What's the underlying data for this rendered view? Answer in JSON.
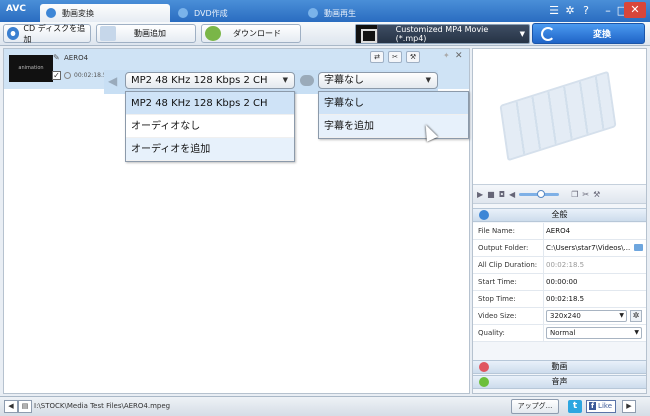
{
  "titlebar": {
    "app_logo": "AVC",
    "tabs": [
      {
        "label": "動画変換",
        "active": true
      },
      {
        "label": "DVD作成",
        "active": false
      },
      {
        "label": "動画再生",
        "active": false
      }
    ]
  },
  "toolbar": {
    "add_cd_label": "CD ディスクを追加",
    "add_video_label": "動画追加",
    "download_label": "ダウンロード",
    "output_format": "Customized MP4 Movie (*.mp4)",
    "convert_label": "変換"
  },
  "file": {
    "name": "AERO4",
    "duration": "00:02:18.5",
    "checked": true
  },
  "audio": {
    "selected": "MP2 48 KHz 128 Kbps 2 CH",
    "options": [
      "MP2 48 KHz 128 Kbps 2 CH",
      "オーディオなし",
      "オーディオを追加"
    ]
  },
  "subtitle": {
    "selected": "字幕なし",
    "options": [
      "字幕なし",
      "字幕を追加"
    ]
  },
  "properties": {
    "general_header": "全般",
    "rows": [
      {
        "label": "File Name:",
        "value": "AERO4"
      },
      {
        "label": "Output Folder:",
        "value": "C:\\Users\\star7\\Videos\\..."
      },
      {
        "label": "All Clip Duration:",
        "value": "00:02:18.5"
      },
      {
        "label": "Start Time:",
        "value": "00:00:00"
      },
      {
        "label": "Stop Time:",
        "value": "00:02:18.5"
      },
      {
        "label": "Video Size:",
        "value": "320x240"
      },
      {
        "label": "Quality:",
        "value": "Normal"
      }
    ],
    "video_header": "動画",
    "audio_header": "音声"
  },
  "statusbar": {
    "path": "I:\\STOCK\\Media Test Files\\AERO4.mpeg",
    "upgrade_label": "アップグ...",
    "twitter_label": "t",
    "facebook_label": "Like"
  },
  "colors": {
    "titlebar": "#2a6cc0",
    "accent": "#1f64c7",
    "selection": "#cfe3f7"
  }
}
